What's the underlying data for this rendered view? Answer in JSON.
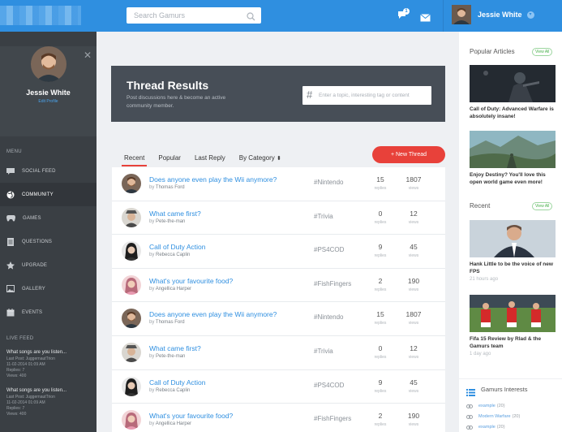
{
  "topbar": {
    "search_placeholder": "Search Gamurs",
    "notification_count": "1",
    "user_name": "Jessie White"
  },
  "sidebar": {
    "user_name": "Jessie White",
    "edit_profile": "Edit Profile",
    "menu_label": "MENU",
    "items": [
      {
        "label": "SOCIAL FEED",
        "icon": "speech-bubble-icon",
        "active": false
      },
      {
        "label": "COMMUNITY",
        "icon": "globe-icon",
        "active": true
      },
      {
        "label": "GAMES",
        "icon": "gamepad-icon",
        "active": false
      },
      {
        "label": "QUESTIONS",
        "icon": "list-icon",
        "active": false
      },
      {
        "label": "UPGRADE",
        "icon": "star-icon",
        "active": false
      },
      {
        "label": "GALLERY",
        "icon": "image-icon",
        "active": false
      },
      {
        "label": "EVENTS",
        "icon": "calendar-icon",
        "active": false
      }
    ],
    "live_feed_label": "LIVE FEED",
    "live_feed": [
      {
        "title": "What songs are you listen...",
        "last_post": "Last Post: JuggernautTrion",
        "date": "11-02-2014 01:09 AM",
        "replies": "Replies: 7",
        "views": "Views: 400"
      },
      {
        "title": "What songs are you listen...",
        "last_post": "Last Post: JuggernautTrion",
        "date": "11-02-2014 01:09 AM",
        "replies": "Replies: 7",
        "views": "Views: 400"
      }
    ]
  },
  "hero": {
    "title": "Thread Results",
    "subtitle": "Post discussions here & become an active community member.",
    "topic_placeholder": "Enter a topic, interesting tag or content"
  },
  "tabs": [
    {
      "label": "Recent",
      "active": true
    },
    {
      "label": "Popular",
      "active": false
    },
    {
      "label": "Last Reply",
      "active": false
    },
    {
      "label": "By Category",
      "active": false
    }
  ],
  "new_thread_label": "+ New Thread",
  "threads": [
    {
      "title": "Does anyone even play the Wii anymore?",
      "by": "by",
      "author": "Thomas Ford",
      "tag": "#Nintendo",
      "replies": "15",
      "views": "1807",
      "avatar": "man-beard"
    },
    {
      "title": "What came first?",
      "by": "by",
      "author": "Pete-the-man",
      "tag": "#Trivia",
      "replies": "0",
      "views": "12",
      "avatar": "man-hat"
    },
    {
      "title": "Call of Duty Action",
      "by": "by",
      "author": "Rebecca Caplin",
      "tag": "#PS4COD",
      "replies": "9",
      "views": "45",
      "avatar": "woman-dark"
    },
    {
      "title": "What's your favourite food?",
      "by": "by",
      "author": "Angellica Harper",
      "tag": "#FishFingers",
      "replies": "2",
      "views": "190",
      "avatar": "woman-pink"
    },
    {
      "title": "Does anyone even play the Wii anymore?",
      "by": "by",
      "author": "Thomas Ford",
      "tag": "#Nintendo",
      "replies": "15",
      "views": "1807",
      "avatar": "man-beard"
    },
    {
      "title": "What came first?",
      "by": "by",
      "author": "Pete-the-man",
      "tag": "#Trivia",
      "replies": "0",
      "views": "12",
      "avatar": "man-hat"
    },
    {
      "title": "Call of Duty Action",
      "by": "by",
      "author": "Rebecca Caplin",
      "tag": "#PS4COD",
      "replies": "9",
      "views": "45",
      "avatar": "woman-dark"
    },
    {
      "title": "What's your favourite food?",
      "by": "by",
      "author": "Angellica Harper",
      "tag": "#FishFingers",
      "replies": "2",
      "views": "190",
      "avatar": "woman-pink"
    }
  ],
  "labels": {
    "replies": "replies",
    "views": "views"
  },
  "right": {
    "popular_title": "Popular Articles",
    "view_all": "View All",
    "popular": [
      {
        "title": "Call of Duty: Advanced Warfare is absolutely insane!",
        "image": "soldier-dark"
      },
      {
        "title": "Enjoy Destiny? You'll love this open world game even more!",
        "image": "landscape"
      }
    ],
    "recent_title": "Recent",
    "recent": [
      {
        "title": "Hank Little to be the voice of new FPS",
        "date": "21 hours ago",
        "image": "man-suit"
      },
      {
        "title": "Fifa 15 Review by Rlad & the Gamurs team",
        "date": "1 day ago",
        "image": "football"
      }
    ],
    "interests_title": "Gamurs Interests",
    "interests": [
      {
        "label": "example",
        "count": "(20)"
      },
      {
        "label": "Modern Warfare",
        "count": "(20)"
      },
      {
        "label": "example",
        "count": "(20)"
      }
    ]
  },
  "colors": {
    "accent_blue": "#2f8fe0",
    "accent_red": "#e8413a",
    "sidebar": "#3a3f44",
    "hero": "#474e57"
  }
}
